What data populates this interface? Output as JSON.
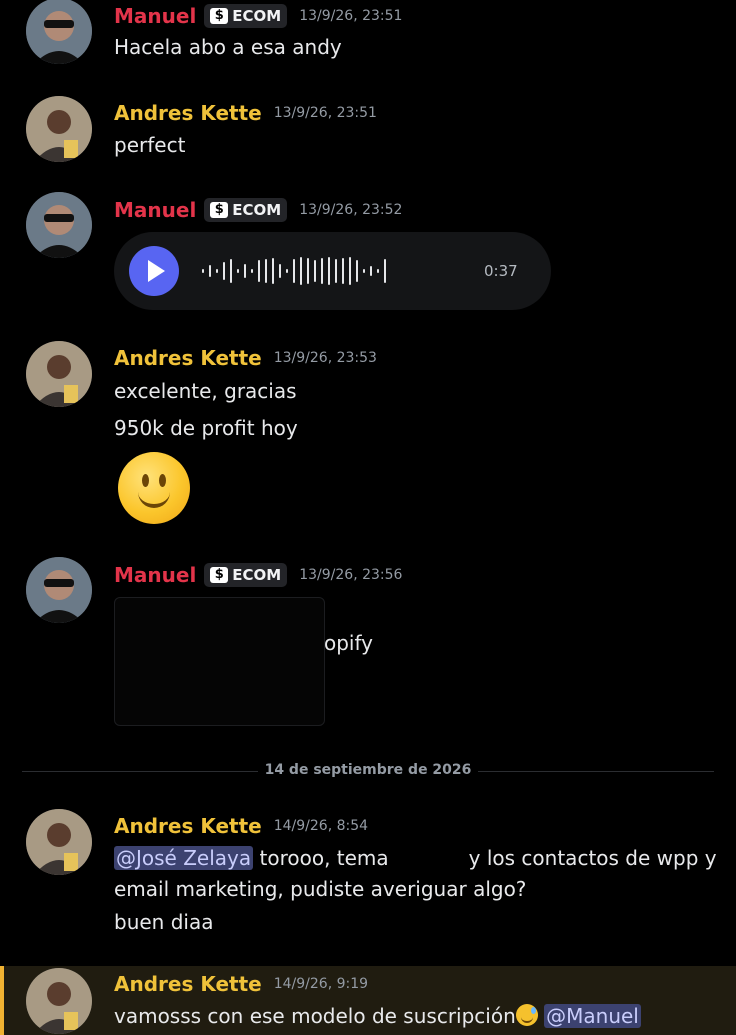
{
  "messages": [
    {
      "author": "Manuel",
      "badge": "ECOM",
      "timestamp": "13/9/26, 23:51",
      "lines": [
        "Hacela abo a esa andy"
      ]
    },
    {
      "author": "Andres Kette",
      "timestamp": "13/9/26, 23:51",
      "lines": [
        "perfect"
      ]
    },
    {
      "author": "Manuel",
      "badge": "ECOM",
      "timestamp": "13/9/26, 23:52",
      "voice": {
        "duration": "0:37"
      }
    },
    {
      "author": "Andres Kette",
      "timestamp": "13/9/26, 23:53",
      "lines": [
        "excelente, gracias",
        "950k de profit hoy"
      ],
      "emoji": "slightly-smiling-face"
    },
    {
      "author": "Manuel",
      "badge": "ECOM",
      "timestamp": "13/9/26, 23:56",
      "attachment_text": "opify"
    },
    {
      "author": "Andres Kette",
      "timestamp": "14/9/26, 8:54",
      "mention": "@José Zelaya",
      "line1_a": "torooo, tema",
      "line1_b": "y los contactos de wpp y",
      "line2": "email marketing, pudiste averiguar algo?",
      "line3": "buen diaa"
    },
    {
      "author": "Andres Kette",
      "timestamp": "14/9/26, 9:19",
      "text": "vamosss con ese modelo de suscripción",
      "mention": "@Manuel"
    }
  ],
  "date_divider": "14 de septiembre de 2026",
  "colors": {
    "manuel": "#e3344a",
    "andres": "#f0c23a",
    "mention_bg": "#3c4270",
    "background": "#000000"
  }
}
